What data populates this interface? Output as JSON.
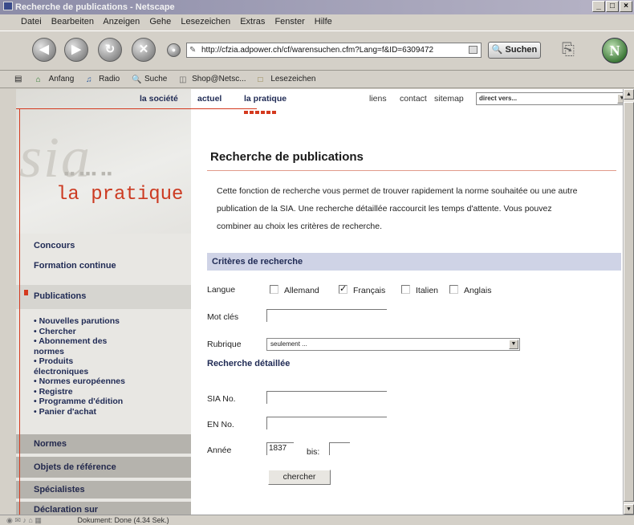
{
  "window": {
    "title": "Recherche de publications - Netscape",
    "controls": [
      "_",
      "□",
      "×"
    ]
  },
  "menu": [
    "Datei",
    "Bearbeiten",
    "Anzeigen",
    "Gehe",
    "Lesezeichen",
    "Extras",
    "Fenster",
    "Hilfe"
  ],
  "navbar": {
    "url": "http://cfzia.adpower.ch/cf/warensuchen.cfm?Lang=f&ID=6309472",
    "search_label": "Suchen",
    "logo_letter": "N"
  },
  "bookmarks": [
    "Anfang",
    "Radio",
    "Suche",
    "Shop@Netsc...",
    "Lesezeichen"
  ],
  "site_nav": {
    "items": [
      "la société",
      "actuel",
      "la pratique"
    ],
    "utils": [
      "liens",
      "contact",
      "sitemap"
    ],
    "direct_placeholder": "direct vers..."
  },
  "sidebar": {
    "watermark": "sia",
    "section_title": "la pratique",
    "top_items": [
      "Concours",
      "Formation continue"
    ],
    "selected_item": "Publications",
    "sub_items": [
      "• Nouvelles parutions",
      "• Chercher",
      "• Abonnement des",
      "normes",
      "• Produits",
      "électroniques",
      "• Normes européennes",
      "• Registre",
      "• Programme d'édition",
      "• Panier d'achat"
    ],
    "bottom_items": [
      "Normes",
      "Objets de référence",
      "Spécialistes",
      "Déclaration sur"
    ]
  },
  "main": {
    "title": "Recherche de publications",
    "intro_lines": [
      "Cette fonction de recherche vous permet de trouver rapidement la norme souhaitée ou une autre",
      "publication de la SIA. Une recherche détaillée raccourcit les temps d'attente. Vous pouvez",
      "combiner au choix les critères de recherche."
    ],
    "criteria_heading": "Critères de recherche",
    "langue_label": "Langue",
    "languages": [
      {
        "label": "Allemand",
        "checked": false
      },
      {
        "label": "Français",
        "checked": true
      },
      {
        "label": "Italien",
        "checked": false
      },
      {
        "label": "Anglais",
        "checked": false
      }
    ],
    "motcles_label": "Mot clés",
    "motcles_value": "",
    "rubrique_label": "Rubrique",
    "rubrique_value": "seulement ...",
    "detail_heading": "Recherche détaillée",
    "sia_label": "SIA No.",
    "sia_value": "",
    "en_label": "EN No.",
    "en_value": "",
    "annee_label": "Année",
    "annee_from": "1837",
    "bis_label": "bis:",
    "annee_to": "",
    "search_button": "chercher"
  },
  "status": {
    "text": "Dokument: Done (4.34 Sek.)"
  },
  "colors": {
    "accent_red": "#d43a1f",
    "nav_blue": "#1f2a54",
    "criteria_bg": "#cfd3e6"
  }
}
